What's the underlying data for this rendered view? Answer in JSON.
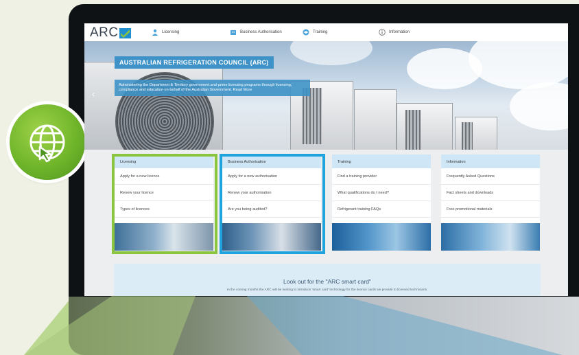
{
  "logo": {
    "text": "ARC"
  },
  "nav": [
    {
      "label": "Licensing",
      "icon": "person-icon"
    },
    {
      "label": "Business Authorisation",
      "icon": "building-icon"
    },
    {
      "label": "Training",
      "icon": "graduation-cap-icon"
    },
    {
      "label": "Information",
      "icon": "info-icon"
    }
  ],
  "hero": {
    "title": "AUSTRALIAN REFRIGERATION COUNCIL (ARC)",
    "text": "Administering the Department & Territory government and prime licensing programs through licensing, compliance and education on behalf of the Australian Government. Read More"
  },
  "cards": [
    {
      "header": "Licensing",
      "links": [
        "Apply for a new licence",
        "Renew your licence",
        "Types of licences"
      ]
    },
    {
      "header": "Business Authorisation",
      "links": [
        "Apply for a new authorisation",
        "Renew your authorisation",
        "Are you being audited?"
      ]
    },
    {
      "header": "Training",
      "links": [
        "Find a training provider",
        "What qualifications do I need?",
        "Refrigerant training FAQs"
      ]
    },
    {
      "header": "Information",
      "links": [
        "Frequently Asked Questions",
        "Fact sheets and downloads",
        "Free promotional materials"
      ]
    }
  ],
  "banner": {
    "title": "Look out for the \"ARC smart card\"",
    "text": "In the coming months the ARC will be looking to introduce 'smart card' technology for the licence cards we provide to licensed technicians."
  },
  "colors": {
    "accent_green": "#8bc53f",
    "accent_blue": "#1ea3dc",
    "brand_blue": "#3e92c7"
  }
}
